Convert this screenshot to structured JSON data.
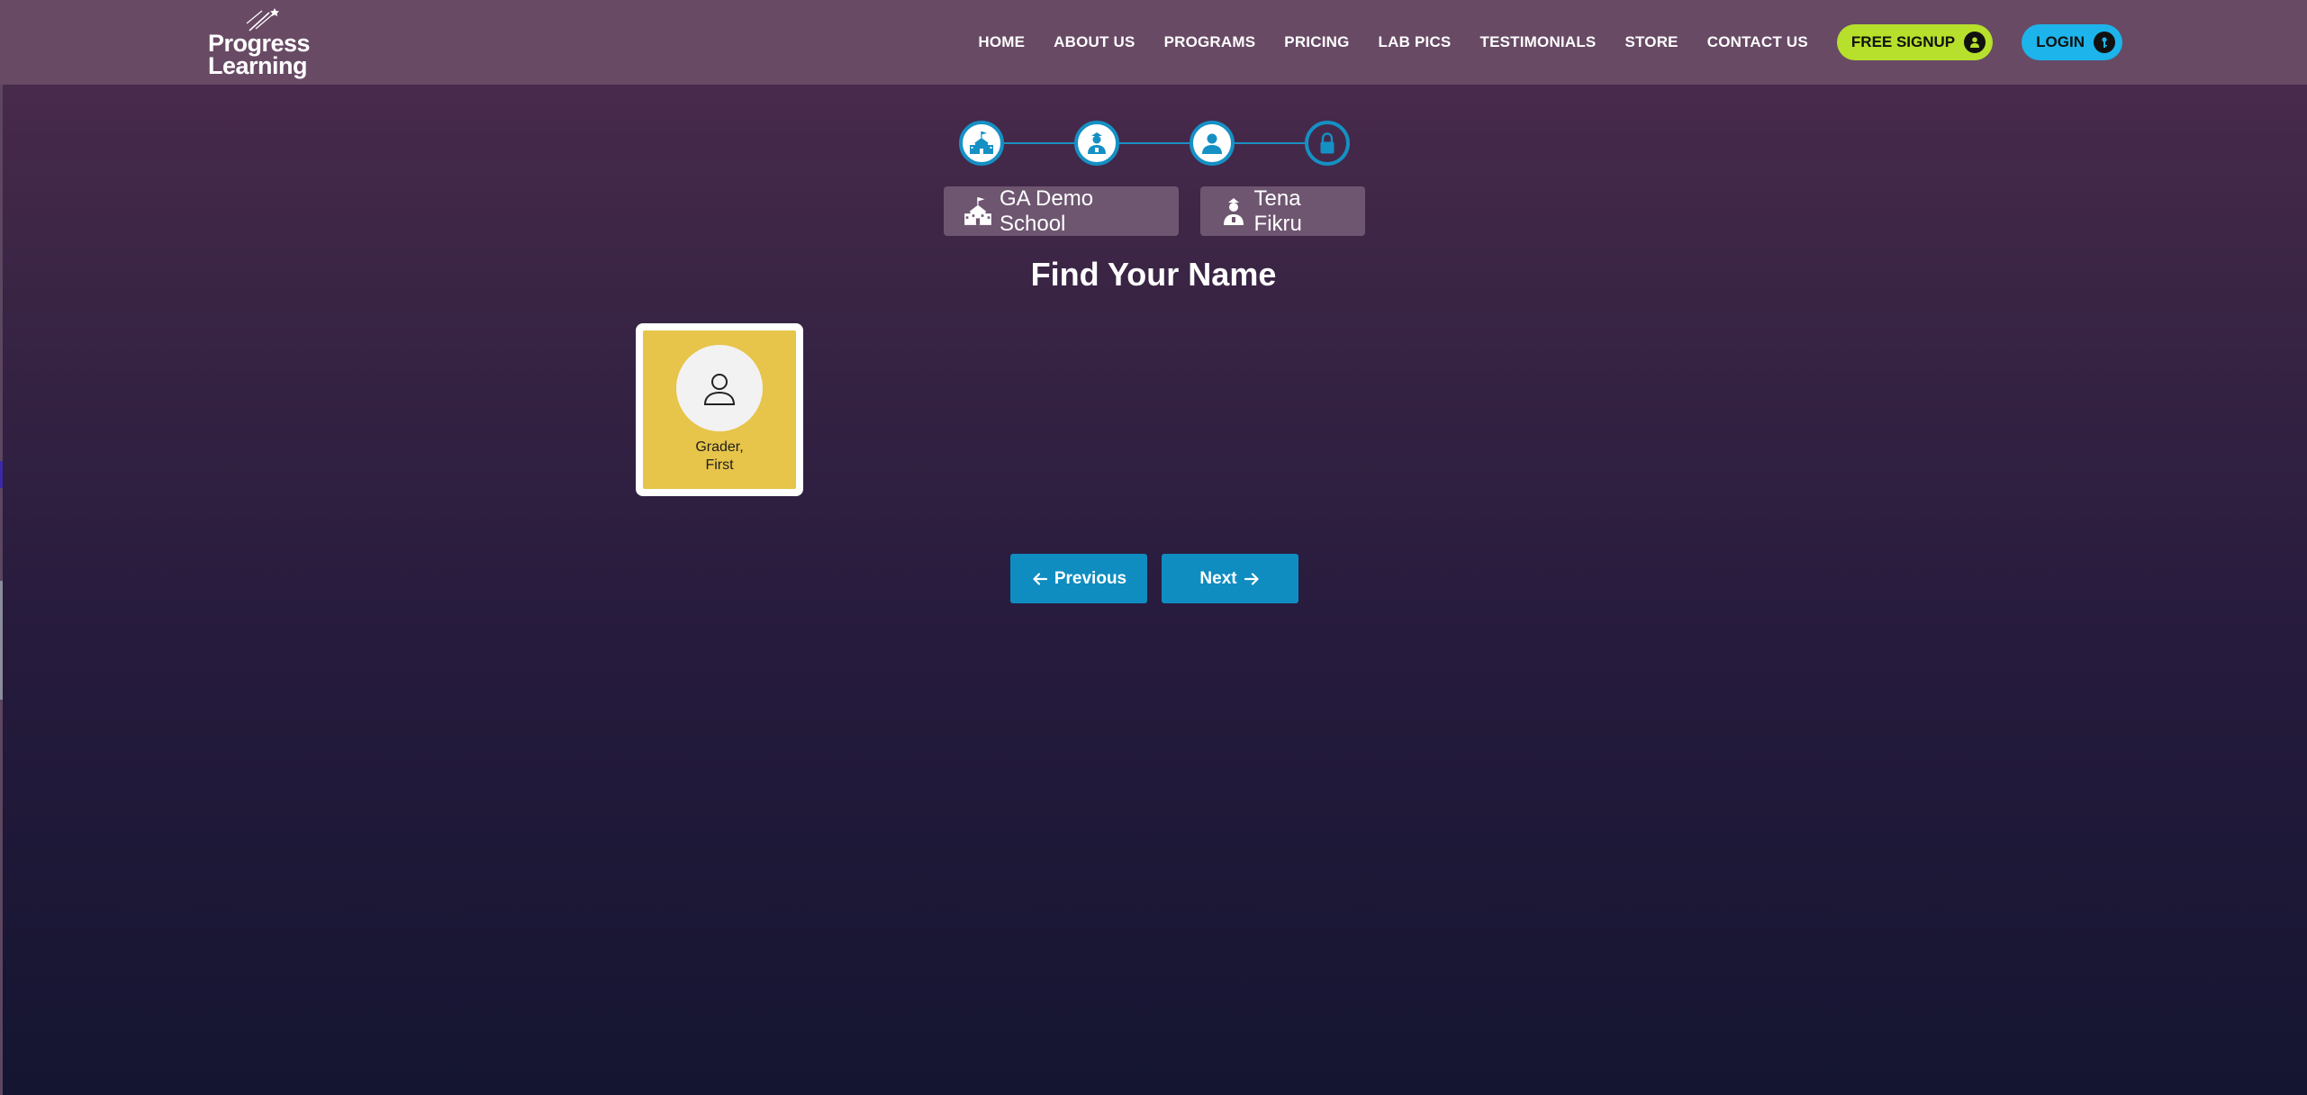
{
  "header": {
    "logo_line1": "Progress",
    "logo_line2": "Learning",
    "nav": {
      "home": "HOME",
      "about": "ABOUT US",
      "programs": "PROGRAMS",
      "pricing": "PRICING",
      "lab_pics": "LAB PICS",
      "testimonials": "TESTIMONIALS",
      "store": "STORE",
      "contact": "CONTACT US"
    },
    "signup_label": "FREE SIGNUP",
    "login_label": "LOGIN"
  },
  "stepper": {
    "steps": [
      {
        "icon": "school-icon",
        "state": "done"
      },
      {
        "icon": "teacher-icon",
        "state": "done"
      },
      {
        "icon": "student-icon",
        "state": "done"
      },
      {
        "icon": "lock-icon",
        "state": "todo"
      }
    ]
  },
  "breadcrumb": {
    "school": "GA Demo School",
    "teacher": "Tena Fikru"
  },
  "main": {
    "title": "Find Your Name",
    "students": [
      {
        "name_line1": "Grader,",
        "name_line2": "First"
      }
    ]
  },
  "actions": {
    "previous_label": "Previous",
    "next_label": "Next"
  },
  "colors": {
    "header_bg": "#684a65",
    "accent_blue": "#0f8dc1",
    "signup_green": "#b6e02c",
    "login_blue": "#1cb4ea",
    "card_yellow": "#e7c44a",
    "chip_bg": "#6e5670"
  }
}
